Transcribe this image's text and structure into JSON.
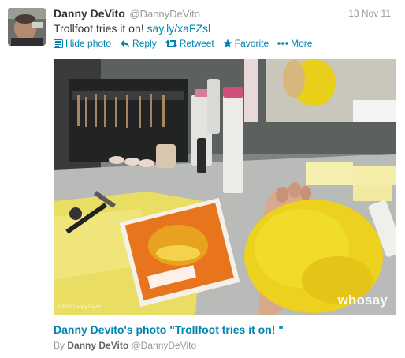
{
  "tweet": {
    "fullname": "Danny DeVito",
    "username": "@DannyDeVito",
    "timestamp": "13 Nov 11",
    "text": "Trollfoot tries it on! ",
    "link": "say.ly/xaFZsl"
  },
  "actions": [
    {
      "label": "Hide photo",
      "icon": "photo-icon"
    },
    {
      "label": "Reply",
      "icon": "reply-icon"
    },
    {
      "label": "Retweet",
      "icon": "retweet-icon"
    },
    {
      "label": "Favorite",
      "icon": "star-icon"
    },
    {
      "label": "More",
      "icon": "more-dots-icon"
    }
  ],
  "media": {
    "watermark": "whosay",
    "copyright": "© 2012 Danny DeVito"
  },
  "caption": {
    "title": "Danny Devito's photo \"Trollfoot tries it on! \"",
    "by_prefix": "By",
    "by_name": "Danny DeVito",
    "by_username": "@DannyDeVito"
  },
  "colors": {
    "link": "#0084b4",
    "muted": "#999999",
    "text": "#333333"
  }
}
